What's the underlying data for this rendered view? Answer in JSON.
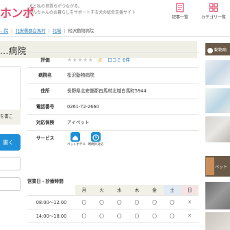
{
  "header": {
    "logo_text": "ホンポ",
    "logo_super": "わんちゃん",
    "tagline_1": "犬と私の良質ちがつながる。",
    "tagline_2": "わんちゃんのお暮らしをサポートする犬の総合支援サイト",
    "nav": [
      {
        "label": "記事一覧",
        "icon": "document-list-icon"
      },
      {
        "label": "カテゴリ一覧",
        "icon": "category-grid-icon"
      }
    ]
  },
  "breadcrumb": {
    "items": [
      "...院",
      "北安曇郡白馬村",
      "北城",
      "松沢動物病院"
    ]
  },
  "title": "...病院",
  "sidebar": {
    "header_label": "動物病",
    "category_label": "ペット"
  },
  "left": {
    "note_1": "を書こ",
    "note_2": "",
    "button_label": "書く"
  },
  "info": {
    "rows": [
      {
        "label": "評価",
        "stars": "★★★★★",
        "rating": "-点",
        "reviews": "口コミ 0件"
      },
      {
        "label": "病院名",
        "value": "松沢動物病院"
      },
      {
        "label": "住所",
        "value": "長野県北安曇郡白馬村北城白馬町5944"
      },
      {
        "label": "電話番号",
        "value": "0261-72-2660"
      },
      {
        "label": "対応保険",
        "value": "アイペット"
      }
    ],
    "services_label": "サービス",
    "services": [
      {
        "label": "ペットホテル",
        "icon": "pet-hotel-icon"
      },
      {
        "label": "時間外対応",
        "icon": "clock-icon"
      }
    ]
  },
  "hours": {
    "title": "営業日・診療時間",
    "days": [
      "月",
      "火",
      "水",
      "木",
      "金",
      "土",
      "日"
    ],
    "rows": [
      {
        "time": "08:00〜12:00",
        "marks": [
          "〇",
          "〇",
          "〇",
          "〇",
          "〇",
          "〇",
          "×"
        ]
      },
      {
        "time": "14:00〜18:00",
        "marks": [
          "〇",
          "〇",
          "〇",
          "〇",
          "〇",
          "〇",
          "×"
        ]
      }
    ]
  },
  "colors": {
    "brand": "#e64b6e",
    "link": "#2a7ab8",
    "accent_blue": "#1e8fd8",
    "sidebar_brown": "#6b5a48"
  }
}
